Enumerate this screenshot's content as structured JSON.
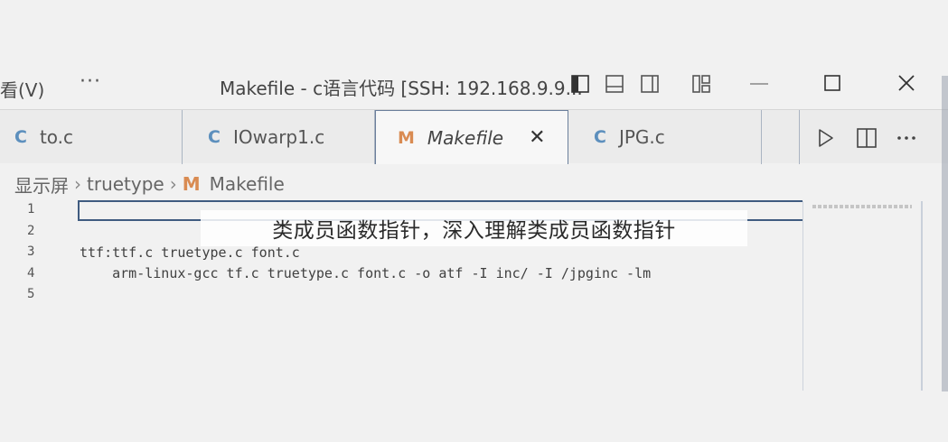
{
  "titlebar": {
    "menu_view": "看(V)",
    "more": "···",
    "window_title": "Makefile - c语言代码 [SSH: 192.168.9.9..."
  },
  "tabs": [
    {
      "icon": "C",
      "label": "to.c"
    },
    {
      "icon": "C",
      "label": "IOwarp1.c"
    },
    {
      "icon": "M",
      "label": "Makefile",
      "close": "✕"
    },
    {
      "icon": "C",
      "label": "JPG.c"
    }
  ],
  "breadcrumb": {
    "folder1": "显示屏",
    "sep": "›",
    "folder2": "truetype",
    "file_icon": "M",
    "file": "Makefile"
  },
  "editor": {
    "line_numbers": [
      "1",
      "2",
      "3",
      "4",
      "5"
    ],
    "lines": [
      "",
      "",
      "ttf:ttf.c truetype.c font.c",
      "    arm-linux-gcc tf.c truetype.c font.c -o atf -I inc/ -I /jpginc -lm",
      ""
    ]
  },
  "subtitle": "类成员函数指针，深入理解类成员函数指针",
  "colors": {
    "c_icon": "#5c8fbd",
    "m_icon": "#d98b52",
    "active_border": "#3f5b80"
  },
  "icons": [
    "toggle-primary-sidebar-icon",
    "toggle-panel-icon",
    "toggle-secondary-sidebar-icon",
    "customize-layout-icon",
    "minimize-icon",
    "maximize-icon",
    "close-icon",
    "run-icon",
    "split-editor-icon",
    "more-actions-icon"
  ]
}
